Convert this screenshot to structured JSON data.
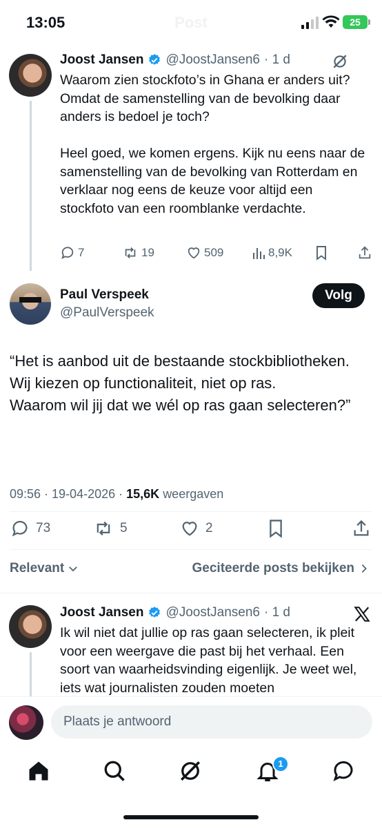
{
  "status_bar": {
    "time": "13:05",
    "battery": "25"
  },
  "header": {
    "title": "Post"
  },
  "parent_tweet": {
    "display_name": "Joost Jansen",
    "handle": "@JoostJansen6",
    "time": "· 1 d",
    "text": "Waarom zien stockfoto’s in Ghana er anders uit? Omdat de samenstelling van de bevolking daar anders is bedoel je toch?\n\nHeel goed, we komen ergens. Kijk nu eens naar de samenstelling van de bevolking van Rotterdam en verklaar nog eens de keuze voor altijd een stockfoto van een roomblanke verdachte.",
    "replies": "7",
    "reposts": "19",
    "likes": "509",
    "views": "8,9K"
  },
  "main_tweet": {
    "display_name": "Paul Verspeek",
    "handle": "@PaulVerspeek",
    "follow_label": "Volg",
    "text": "“Het is aanbod uit de bestaande stockbibliotheken.\nWij kiezen op functionaliteit, niet op ras.\nWaarom wil jij dat we wél op ras gaan selecteren?”",
    "timestamp": "09:56 · 19-04-2026 ·",
    "views_count": "15,6K",
    "views_label": "weergaven",
    "replies": "73",
    "reposts": "5",
    "likes": "2"
  },
  "sort": {
    "relevant_label": "Relevant",
    "quoted_label": "Geciteerde posts bekijken"
  },
  "reply_tweet": {
    "display_name": "Joost Jansen",
    "handle": "@JoostJansen6",
    "time": "· 1 d",
    "text": "Ik wil niet dat jullie op ras gaan selecteren, ik pleit voor een weergave die past bij het verhaal. Een soort van waarheidsvinding eigenlijk. Je weet wel, iets wat journalisten zouden moeten"
  },
  "composer": {
    "placeholder": "Plaats je antwoord"
  },
  "tabbar": {
    "notifications_badge": "1"
  },
  "colors": {
    "accent": "#1d9bf0",
    "text": "#0f1419",
    "secondary": "#536471"
  }
}
